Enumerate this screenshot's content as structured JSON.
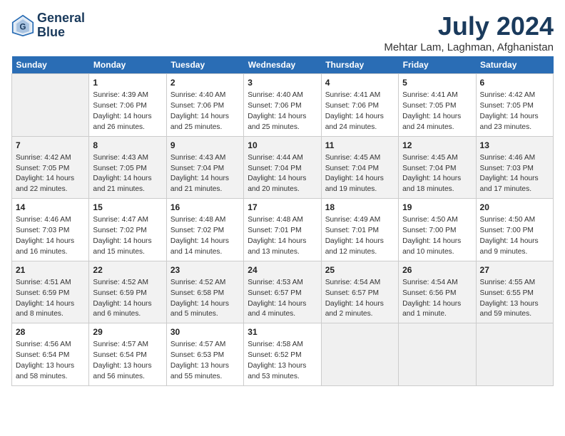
{
  "header": {
    "logo_line1": "General",
    "logo_line2": "Blue",
    "month_year": "July 2024",
    "location": "Mehtar Lam, Laghman, Afghanistan"
  },
  "weekdays": [
    "Sunday",
    "Monday",
    "Tuesday",
    "Wednesday",
    "Thursday",
    "Friday",
    "Saturday"
  ],
  "weeks": [
    [
      {
        "day": "",
        "info": ""
      },
      {
        "day": "1",
        "info": "Sunrise: 4:39 AM\nSunset: 7:06 PM\nDaylight: 14 hours\nand 26 minutes."
      },
      {
        "day": "2",
        "info": "Sunrise: 4:40 AM\nSunset: 7:06 PM\nDaylight: 14 hours\nand 25 minutes."
      },
      {
        "day": "3",
        "info": "Sunrise: 4:40 AM\nSunset: 7:06 PM\nDaylight: 14 hours\nand 25 minutes."
      },
      {
        "day": "4",
        "info": "Sunrise: 4:41 AM\nSunset: 7:06 PM\nDaylight: 14 hours\nand 24 minutes."
      },
      {
        "day": "5",
        "info": "Sunrise: 4:41 AM\nSunset: 7:05 PM\nDaylight: 14 hours\nand 24 minutes."
      },
      {
        "day": "6",
        "info": "Sunrise: 4:42 AM\nSunset: 7:05 PM\nDaylight: 14 hours\nand 23 minutes."
      }
    ],
    [
      {
        "day": "7",
        "info": "Sunrise: 4:42 AM\nSunset: 7:05 PM\nDaylight: 14 hours\nand 22 minutes."
      },
      {
        "day": "8",
        "info": "Sunrise: 4:43 AM\nSunset: 7:05 PM\nDaylight: 14 hours\nand 21 minutes."
      },
      {
        "day": "9",
        "info": "Sunrise: 4:43 AM\nSunset: 7:04 PM\nDaylight: 14 hours\nand 21 minutes."
      },
      {
        "day": "10",
        "info": "Sunrise: 4:44 AM\nSunset: 7:04 PM\nDaylight: 14 hours\nand 20 minutes."
      },
      {
        "day": "11",
        "info": "Sunrise: 4:45 AM\nSunset: 7:04 PM\nDaylight: 14 hours\nand 19 minutes."
      },
      {
        "day": "12",
        "info": "Sunrise: 4:45 AM\nSunset: 7:04 PM\nDaylight: 14 hours\nand 18 minutes."
      },
      {
        "day": "13",
        "info": "Sunrise: 4:46 AM\nSunset: 7:03 PM\nDaylight: 14 hours\nand 17 minutes."
      }
    ],
    [
      {
        "day": "14",
        "info": "Sunrise: 4:46 AM\nSunset: 7:03 PM\nDaylight: 14 hours\nand 16 minutes."
      },
      {
        "day": "15",
        "info": "Sunrise: 4:47 AM\nSunset: 7:02 PM\nDaylight: 14 hours\nand 15 minutes."
      },
      {
        "day": "16",
        "info": "Sunrise: 4:48 AM\nSunset: 7:02 PM\nDaylight: 14 hours\nand 14 minutes."
      },
      {
        "day": "17",
        "info": "Sunrise: 4:48 AM\nSunset: 7:01 PM\nDaylight: 14 hours\nand 13 minutes."
      },
      {
        "day": "18",
        "info": "Sunrise: 4:49 AM\nSunset: 7:01 PM\nDaylight: 14 hours\nand 12 minutes."
      },
      {
        "day": "19",
        "info": "Sunrise: 4:50 AM\nSunset: 7:00 PM\nDaylight: 14 hours\nand 10 minutes."
      },
      {
        "day": "20",
        "info": "Sunrise: 4:50 AM\nSunset: 7:00 PM\nDaylight: 14 hours\nand 9 minutes."
      }
    ],
    [
      {
        "day": "21",
        "info": "Sunrise: 4:51 AM\nSunset: 6:59 PM\nDaylight: 14 hours\nand 8 minutes."
      },
      {
        "day": "22",
        "info": "Sunrise: 4:52 AM\nSunset: 6:59 PM\nDaylight: 14 hours\nand 6 minutes."
      },
      {
        "day": "23",
        "info": "Sunrise: 4:52 AM\nSunset: 6:58 PM\nDaylight: 14 hours\nand 5 minutes."
      },
      {
        "day": "24",
        "info": "Sunrise: 4:53 AM\nSunset: 6:57 PM\nDaylight: 14 hours\nand 4 minutes."
      },
      {
        "day": "25",
        "info": "Sunrise: 4:54 AM\nSunset: 6:57 PM\nDaylight: 14 hours\nand 2 minutes."
      },
      {
        "day": "26",
        "info": "Sunrise: 4:54 AM\nSunset: 6:56 PM\nDaylight: 14 hours\nand 1 minute."
      },
      {
        "day": "27",
        "info": "Sunrise: 4:55 AM\nSunset: 6:55 PM\nDaylight: 13 hours\nand 59 minutes."
      }
    ],
    [
      {
        "day": "28",
        "info": "Sunrise: 4:56 AM\nSunset: 6:54 PM\nDaylight: 13 hours\nand 58 minutes."
      },
      {
        "day": "29",
        "info": "Sunrise: 4:57 AM\nSunset: 6:54 PM\nDaylight: 13 hours\nand 56 minutes."
      },
      {
        "day": "30",
        "info": "Sunrise: 4:57 AM\nSunset: 6:53 PM\nDaylight: 13 hours\nand 55 minutes."
      },
      {
        "day": "31",
        "info": "Sunrise: 4:58 AM\nSunset: 6:52 PM\nDaylight: 13 hours\nand 53 minutes."
      },
      {
        "day": "",
        "info": ""
      },
      {
        "day": "",
        "info": ""
      },
      {
        "day": "",
        "info": ""
      }
    ]
  ]
}
